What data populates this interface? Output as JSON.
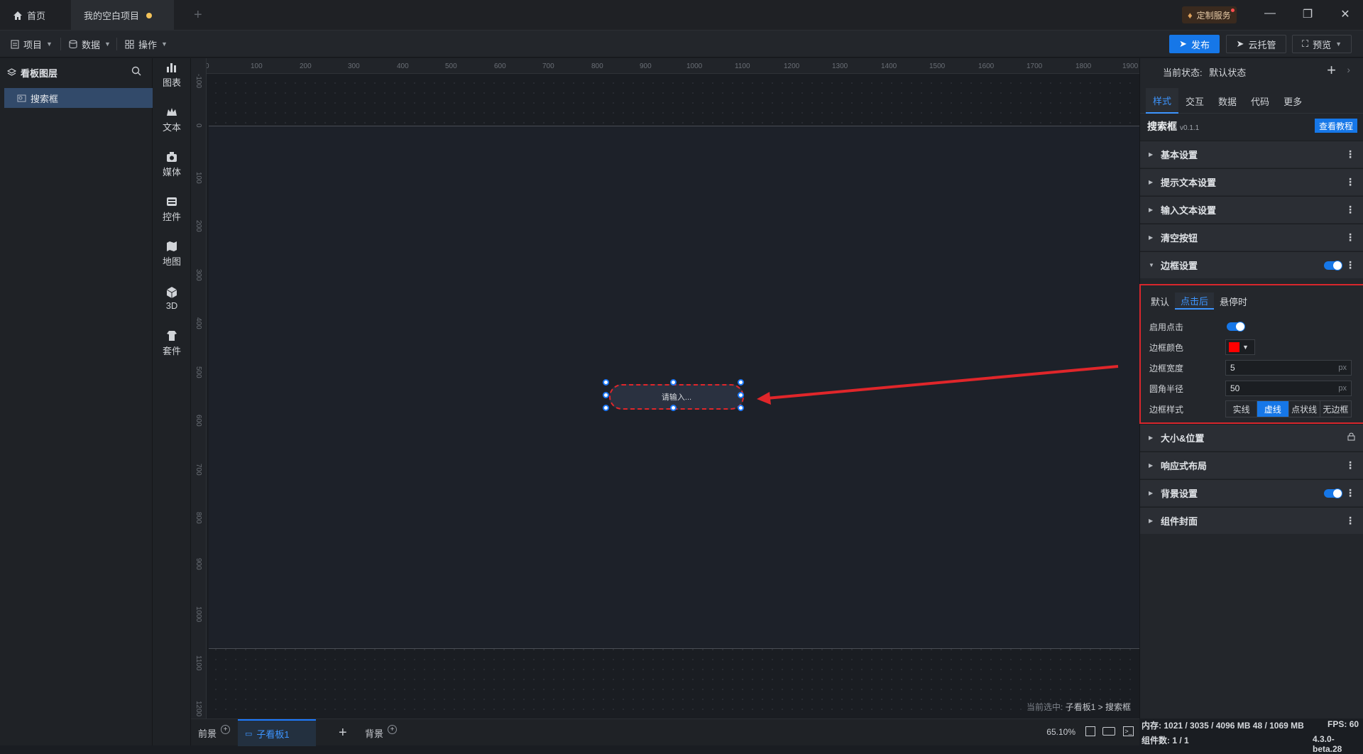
{
  "titlebar": {
    "home_tab": "首页",
    "project_tab": "我的空白项目",
    "service_label": "定制服务"
  },
  "menubar": {
    "project": "项目",
    "data": "数据",
    "operate": "操作",
    "publish": "发布",
    "cloud": "云托管",
    "preview": "预览"
  },
  "layers": {
    "title": "看板图层",
    "items": [
      {
        "label": "搜索框"
      }
    ]
  },
  "components": [
    {
      "label": "图表",
      "icon": "chart-icon"
    },
    {
      "label": "文本",
      "icon": "text-icon"
    },
    {
      "label": "媒体",
      "icon": "media-icon"
    },
    {
      "label": "控件",
      "icon": "control-icon"
    },
    {
      "label": "地图",
      "icon": "map-icon"
    },
    {
      "label": "3D",
      "icon": "cube-icon"
    },
    {
      "label": "套件",
      "icon": "kit-icon"
    }
  ],
  "ruler": {
    "top": [
      "0",
      "100",
      "200",
      "300",
      "400",
      "500",
      "600",
      "700",
      "800",
      "900",
      "1000",
      "1100",
      "1200",
      "1300",
      "1400",
      "1500",
      "1600",
      "1700",
      "1800",
      "1900"
    ],
    "left": [
      "-100",
      "0",
      "100",
      "200",
      "300",
      "400",
      "500",
      "600",
      "700",
      "800",
      "900",
      "1000",
      "1100",
      "1200"
    ]
  },
  "canvas": {
    "searchbox_placeholder": "请输入...",
    "current_selection_prefix": "当前选中:",
    "current_selection_path": "子看板1 > 搜索框"
  },
  "bottombar": {
    "foreground": "前景",
    "subboard": "子看板1",
    "background": "背景",
    "zoom": "65.10%"
  },
  "rightpanel": {
    "state_label": "当前状态:",
    "state_value": "默认状态",
    "tabs": [
      "样式",
      "交互",
      "数据",
      "代码",
      "更多"
    ],
    "component_name": "搜索框",
    "component_version": "v0.1.1",
    "tutorial_button": "查看教程",
    "sections": {
      "basic": "基本设置",
      "hint_text": "提示文本设置",
      "input_text": "输入文本设置",
      "clear_button": "清空按钮",
      "border": "边框设置",
      "size_position": "大小&位置",
      "responsive": "响应式布局",
      "background": "背景设置",
      "cover": "组件封面"
    },
    "border_panel": {
      "tabs": [
        "默认",
        "点击后",
        "悬停时"
      ],
      "active_tab": "点击后",
      "enable_click_label": "启用点击",
      "border_color_label": "边框颜色",
      "border_color": "#ff0000",
      "border_width_label": "边框宽度",
      "border_width": "5",
      "radius_label": "圆角半径",
      "radius": "50",
      "unit": "px",
      "style_label": "边框样式",
      "styles": [
        "实线",
        "虚线",
        "点状线",
        "无边框"
      ],
      "active_style": "虚线"
    }
  },
  "statusbar": {
    "memory_label": "内存:",
    "memory_value": "1021 / 3035 / 4096 MB",
    "memory_extra": "48 / 1069 MB",
    "fps_label": "FPS:",
    "fps_value": "60",
    "components_label": "组件数:",
    "components_value": "1 / 1",
    "version": "4.3.0-beta.28"
  },
  "colors": {
    "accent": "#1677e8",
    "highlight_red": "#d8262c"
  }
}
